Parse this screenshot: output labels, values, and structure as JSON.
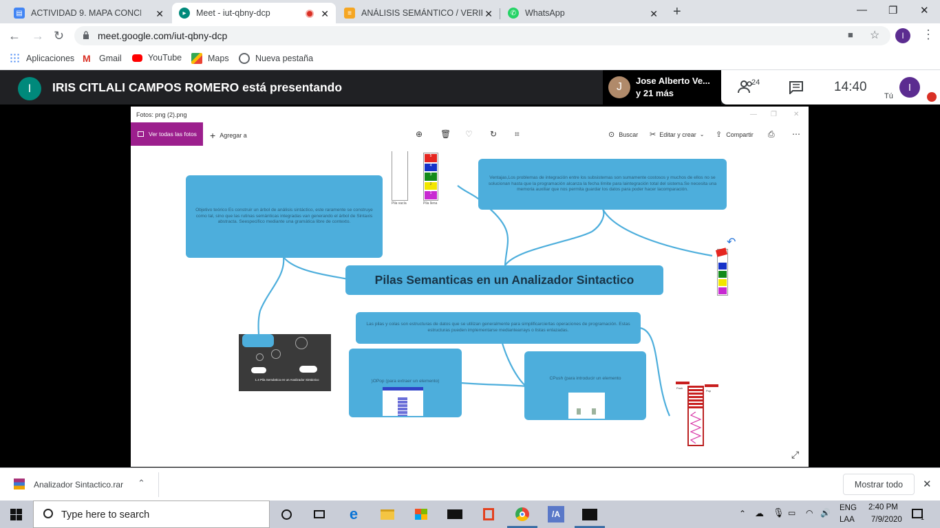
{
  "browser": {
    "tabs": [
      {
        "title": "ACTIVIDAD 9. MAPA CONCEPTUAL",
        "favicon": "docs-icon",
        "active": false
      },
      {
        "title": "Meet - iut-qbny-dcp",
        "favicon": "meet-icon",
        "active": true,
        "recording": true
      },
      {
        "title": "ANÁLISIS SEMÁNTICO / VERIFICACIÓN",
        "favicon": "blog-icon",
        "active": false
      },
      {
        "title": "WhatsApp",
        "favicon": "whatsapp-icon",
        "active": false
      }
    ],
    "url": "meet.google.com/iut-qbny-dcp",
    "profile_initial": "I",
    "bookmarks": [
      {
        "label": "Aplicaciones",
        "icon": "apps-grid-icon"
      },
      {
        "label": "Gmail",
        "icon": "gmail-icon"
      },
      {
        "label": "YouTube",
        "icon": "youtube-icon"
      },
      {
        "label": "Maps",
        "icon": "maps-icon"
      },
      {
        "label": "Nueva pestaña",
        "icon": "globe-icon"
      }
    ]
  },
  "meet": {
    "presenter_initial": "I",
    "presenting_text": "IRIS CITLALI CAMPOS ROMERO está presentando",
    "speaker_initial": "J",
    "speaker_name": "Jose Alberto Ve...",
    "speaker_others": "y 21 más",
    "participants_count": "24",
    "time": "14:40",
    "self_label": "Tú",
    "self_initial": "I"
  },
  "viewer": {
    "title": "Fotos: png (2).png",
    "all_photos": "Ver todas las fotos",
    "add_to": "Agregar a",
    "search": "Buscar",
    "edit": "Editar y crear",
    "share": "Compartir"
  },
  "mindmap": {
    "central": "Pilas Semanticas en un Analizador Sintactico",
    "objective": "Objetivo teórico Es construir un árbol de análisis sintáctico, este raramente se construye como tal, sino que las rutinas semánticas integradas van generando el árbol de Sintaxis abstracta. Seespecifico mediante una gramática libre de contexto.",
    "advantages": "Ventajas,Los problemas de integración entre los subsistemas son sumamente costosos y muchos de ellos no se solucionan hasta que la programación alcanza la fecha límite para laintegración total del sistema.Se necesita una memoria auxiliar que nos permita guardar los datos para poder hacer lacomparación.",
    "stacks": "Las pilas y colas son estructuras de datos que se utilizan generalmente para simplificarciertas operaciones de programación. Estas estructuras pueden implementarse mediantearrays o listas enlazadas.",
    "pop": ")OPop (para extraer un elemento)",
    "push": "CPush (para introducir un elemento",
    "stack_empty": "Pila vacía",
    "stack_full": "Pila llena",
    "slide_caption": "1.4 Pila Semántica en un Analizador Sintáctico",
    "push_label": "Push",
    "pop_label": "Pop",
    "stack_levels": [
      "5",
      "4",
      "3",
      "2",
      "1"
    ]
  },
  "downloads": {
    "file": "Analizador Sintactico.rar",
    "show_all": "Mostrar todo"
  },
  "taskbar": {
    "search_placeholder": "Type here to search",
    "lang1": "ENG",
    "lang2": "LAA",
    "time": "2:40 PM",
    "date": "7/9/2020",
    "notifications": "1"
  }
}
